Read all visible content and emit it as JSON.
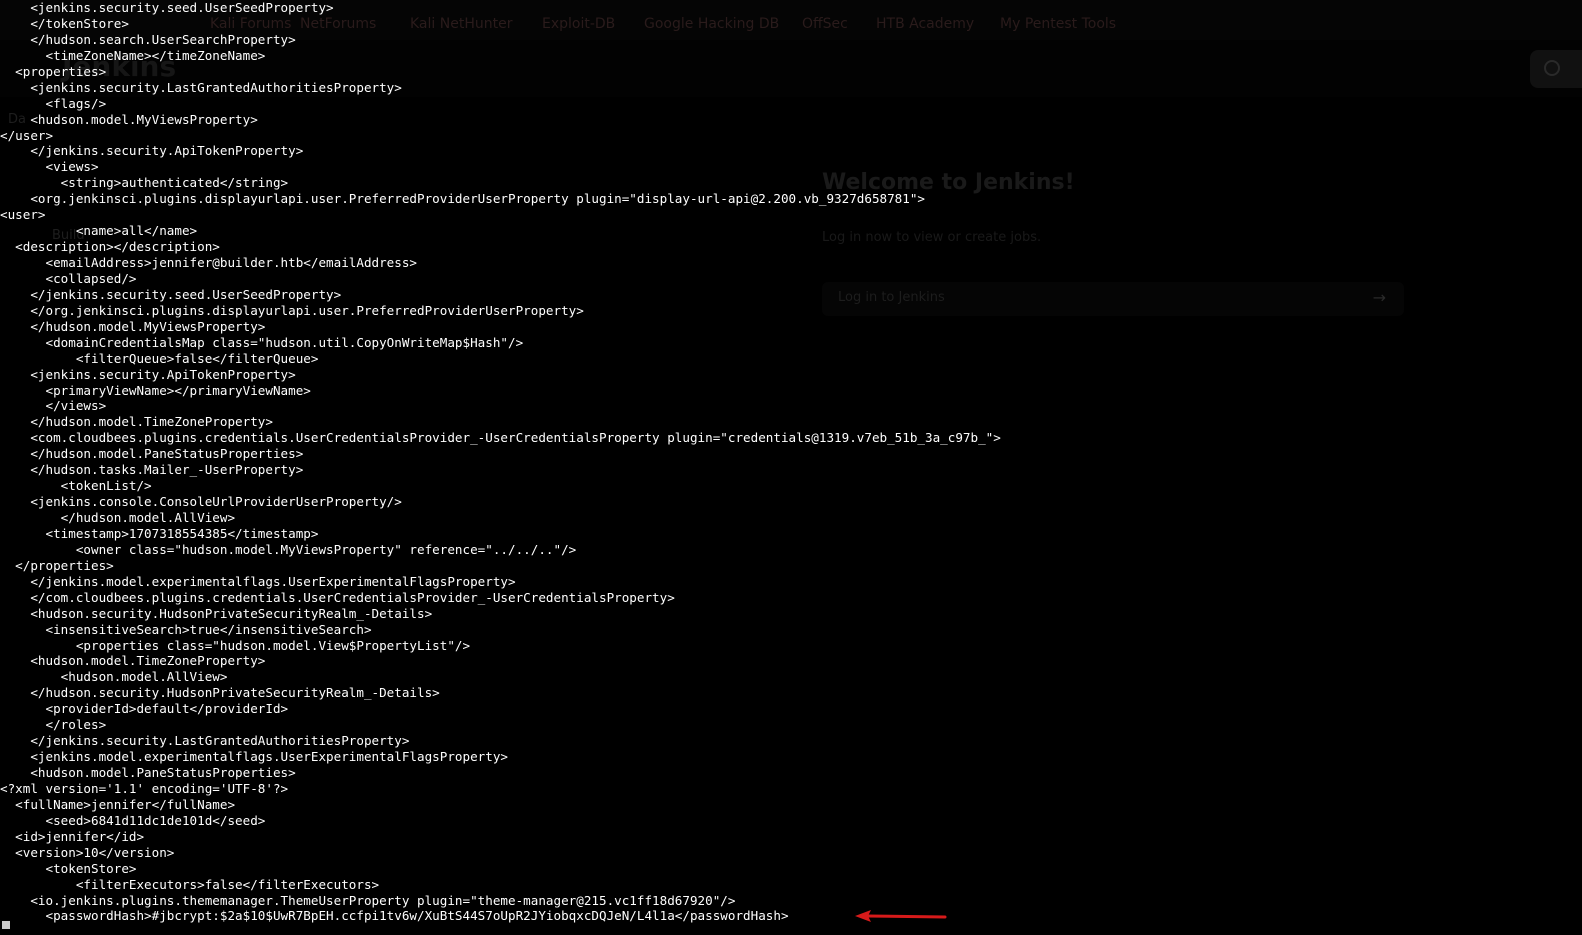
{
  "bookmarks": [
    "Kali Forums",
    "NetForums",
    "Kali NetHunter",
    "Exploit-DB",
    "Google Hacking DB",
    "OffSec",
    "HTB Academy",
    "My Pentest Tools"
  ],
  "jenkins": {
    "logo_text": "Jenkins",
    "welcome_title": "Welcome to Jenkins!",
    "welcome_subtitle": "Log in now to view or create jobs.",
    "login_button": "Log in to Jenkins",
    "sidebar_text": [
      "Da",
      "Build"
    ]
  },
  "terminal_lines": [
    "    <jenkins.security.seed.UserSeedProperty>",
    "    </tokenStore>",
    "    </hudson.search.UserSearchProperty>",
    "      <timeZoneName></timeZoneName>",
    "  <properties>",
    "    <jenkins.security.LastGrantedAuthoritiesProperty>",
    "      <flags/>",
    "    <hudson.model.MyViewsProperty>",
    "</user>",
    "    </jenkins.security.ApiTokenProperty>",
    "      <views>",
    "        <string>authenticated</string>",
    "    <org.jenkinsci.plugins.displayurlapi.user.PreferredProviderUserProperty plugin=\"display-url-api@2.200.vb_9327d658781\">",
    "<user>",
    "          <name>all</name>",
    "  <description></description>",
    "      <emailAddress>jennifer@builder.htb</emailAddress>",
    "      <collapsed/>",
    "    </jenkins.security.seed.UserSeedProperty>",
    "    </org.jenkinsci.plugins.displayurlapi.user.PreferredProviderUserProperty>",
    "    </hudson.model.MyViewsProperty>",
    "      <domainCredentialsMap class=\"hudson.util.CopyOnWriteMap$Hash\"/>",
    "          <filterQueue>false</filterQueue>",
    "    <jenkins.security.ApiTokenProperty>",
    "      <primaryViewName></primaryViewName>",
    "      </views>",
    "    </hudson.model.TimeZoneProperty>",
    "    <com.cloudbees.plugins.credentials.UserCredentialsProvider_-UserCredentialsProperty plugin=\"credentials@1319.v7eb_51b_3a_c97b_\">",
    "    </hudson.model.PaneStatusProperties>",
    "    </hudson.tasks.Mailer_-UserProperty>",
    "        <tokenList/>",
    "    <jenkins.console.ConsoleUrlProviderUserProperty/>",
    "        </hudson.model.AllView>",
    "      <timestamp>1707318554385</timestamp>",
    "          <owner class=\"hudson.model.MyViewsProperty\" reference=\"../../..\"/>",
    "  </properties>",
    "    </jenkins.model.experimentalflags.UserExperimentalFlagsProperty>",
    "    </com.cloudbees.plugins.credentials.UserCredentialsProvider_-UserCredentialsProperty>",
    "    <hudson.security.HudsonPrivateSecurityRealm_-Details>",
    "      <insensitiveSearch>true</insensitiveSearch>",
    "          <properties class=\"hudson.model.View$PropertyList\"/>",
    "    <hudson.model.TimeZoneProperty>",
    "        <hudson.model.AllView>",
    "    </hudson.security.HudsonPrivateSecurityRealm_-Details>",
    "      <providerId>default</providerId>",
    "      </roles>",
    "    </jenkins.security.LastGrantedAuthoritiesProperty>",
    "    <jenkins.model.experimentalflags.UserExperimentalFlagsProperty>",
    "    <hudson.model.PaneStatusProperties>",
    "<?xml version='1.1' encoding='UTF-8'?>",
    "  <fullName>jennifer</fullName>",
    "      <seed>6841d11dc1de101d</seed>",
    "  <id>jennifer</id>",
    "  <version>10</version>",
    "      <tokenStore>",
    "          <filterExecutors>false</filterExecutors>",
    "    <io.jenkins.plugins.thememanager.ThemeUserProperty plugin=\"theme-manager@215.vc1ff18d67920\"/>",
    "      <passwordHash>#jbcrypt:$2a$10$UwR7BpEH.ccfpi1tv6w/XuBtS44S7oUpR2JYiobqxcDQJeN/L4l1a</passwordHash>"
  ],
  "colors": {
    "terminal_text": "#ffffff",
    "background": "#000000",
    "annotation_arrow": "#d61a1a"
  }
}
